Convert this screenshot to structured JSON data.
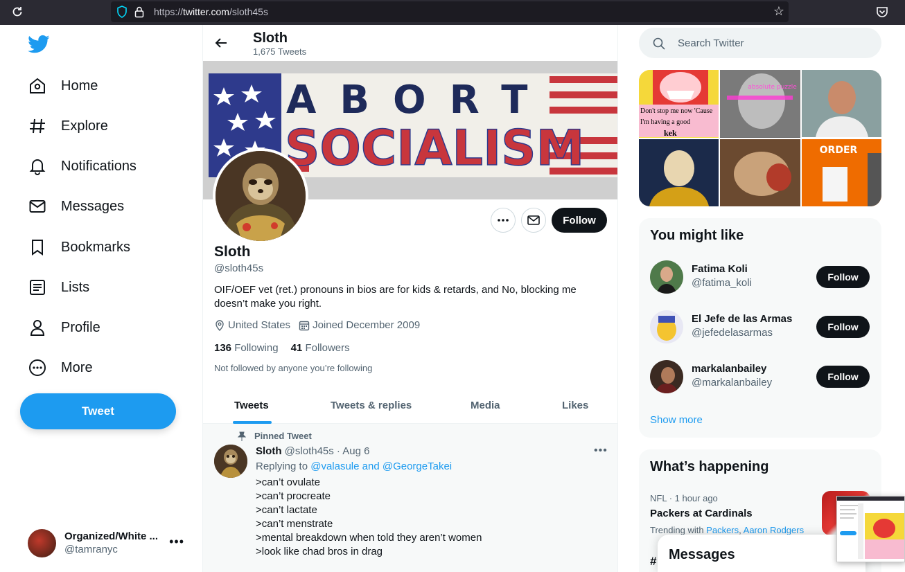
{
  "browser": {
    "url_prefix": "https://",
    "url_host": "twitter.com",
    "url_path": "/sloth45s"
  },
  "nav": {
    "items": [
      {
        "label": "Home",
        "icon": "home-icon"
      },
      {
        "label": "Explore",
        "icon": "hashtag-icon"
      },
      {
        "label": "Notifications",
        "icon": "bell-icon"
      },
      {
        "label": "Messages",
        "icon": "mail-icon"
      },
      {
        "label": "Bookmarks",
        "icon": "bookmark-icon"
      },
      {
        "label": "Lists",
        "icon": "list-icon"
      },
      {
        "label": "Profile",
        "icon": "person-icon"
      },
      {
        "label": "More",
        "icon": "more-circle-icon"
      }
    ],
    "tweet_button": "Tweet",
    "account": {
      "name": "Organized/White ...",
      "handle": "@tamranyc"
    }
  },
  "header": {
    "name": "Sloth",
    "tweet_count": "1,675 Tweets"
  },
  "banner": {
    "line1": "ABORT",
    "line2": "SOCIALISM"
  },
  "profile": {
    "name": "Sloth",
    "handle": "@sloth45s",
    "bio": "OIF/OEF vet (ret.) pronouns in bios are for kids & retards, and No, blocking me doesn’t make you right.",
    "location": "United States",
    "joined": "Joined December 2009",
    "following_count": "136",
    "following_label": "Following",
    "followers_count": "41",
    "followers_label": "Followers",
    "not_followed": "Not followed by anyone you’re following",
    "follow_button": "Follow"
  },
  "tabs": [
    "Tweets",
    "Tweets & replies",
    "Media",
    "Likes"
  ],
  "pinned_tweet": {
    "pinned_label": "Pinned Tweet",
    "name": "Sloth",
    "handle_date": "@sloth45s · Aug 6",
    "replying_prefix": "Replying to ",
    "replying_to": "@valasule and @GeorgeTakei",
    "lines": [
      ">can’t ovulate",
      ">can’t procreate",
      ">can’t lactate",
      ">can’t menstrate",
      ">mental breakdown when told they aren’t women",
      ">look like chad bros in drag"
    ]
  },
  "search": {
    "placeholder": "Search Twitter"
  },
  "media_grid": {
    "meme_text": "Don't stop me now 'Cause I'm having a good",
    "meme_kek": "kek",
    "puzzle_text": "absolute puzzle",
    "order_text": "ORDER"
  },
  "you_might_like": {
    "title": "You might like",
    "users": [
      {
        "name": "Fatima Koli",
        "handle": "@fatima_koli",
        "button": "Follow"
      },
      {
        "name": "El Jefe de las Armas",
        "handle": "@jefedelasarmas",
        "button": "Follow"
      },
      {
        "name": "markalanbailey",
        "handle": "@markalanbailey",
        "button": "Follow"
      }
    ],
    "show_more": "Show more"
  },
  "whats_happening": {
    "title": "What’s happening",
    "trend_meta": "NFL · 1 hour ago",
    "trend_title": "Packers at Cardinals",
    "trend_with_prefix": "Trending with ",
    "trend_with_1": "Packers",
    "trend_with_sep": ", ",
    "trend_with_2": "Aaron Rodgers",
    "next_fragment": "#"
  },
  "messages_drawer": {
    "title": "Messages"
  },
  "colors": {
    "accent": "#1d9bf0",
    "text": "#0f1419",
    "muted": "#536471",
    "browser_bar": "#2b2a33"
  }
}
